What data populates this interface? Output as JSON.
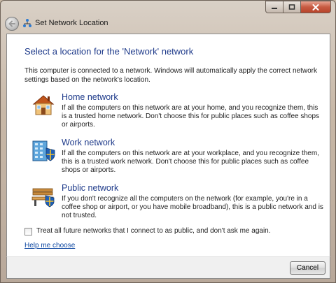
{
  "window": {
    "title": "Set Network Location",
    "icon": "network-icon"
  },
  "content": {
    "heading": "Select a location for the 'Network' network",
    "intro": "This computer is connected to a network. Windows will automatically apply the correct network settings based on the network's location.",
    "options": [
      {
        "title": "Home network",
        "description": "If all the computers on this network are at your home, and you recognize them, this is a trusted home network.  Don't choose this for public places such as coffee shops or airports.",
        "icon": "home-icon"
      },
      {
        "title": "Work network",
        "description": "If all the computers on this network are at your workplace, and you recognize them, this is a trusted work network.  Don't choose this for public places such as coffee shops or airports.",
        "icon": "office-building-icon"
      },
      {
        "title": "Public network",
        "description": "If you don't recognize all the computers on the network (for example, you're in a coffee shop or airport, or you have mobile broadband), this is a public network and is not trusted.",
        "icon": "park-bench-icon"
      }
    ],
    "checkbox": {
      "label": "Treat all future networks that I connect to as public, and don't ask me again.",
      "checked": false
    },
    "help_link": "Help me choose"
  },
  "footer": {
    "cancel_label": "Cancel"
  },
  "colors": {
    "heading": "#1e3a8a",
    "link": "#0d47a1",
    "close_button": "#c75b42"
  }
}
